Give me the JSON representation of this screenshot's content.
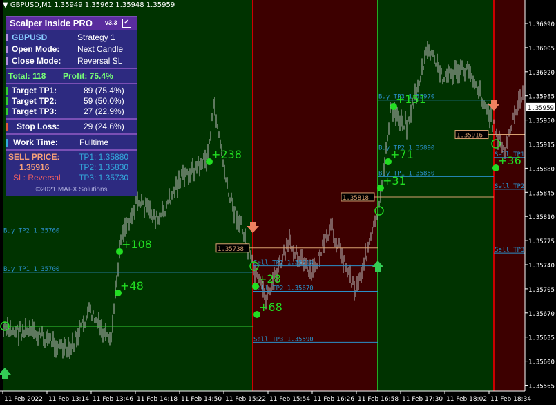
{
  "window": {
    "title": "GBPUSD,M1  1.35949 1.35962 1.35948 1.35959"
  },
  "panel": {
    "title": "Scalper Inside PRO",
    "version": "v3.3",
    "symbol": "GBPUSD",
    "strategy": "Strategy 1",
    "open_mode_label": "Open Mode:",
    "open_mode_value": "Next Candle",
    "close_mode_label": "Close Mode:",
    "close_mode_value": "Reversal SL",
    "total_label": "Total: 118",
    "profit_label": "Profit: 75.4%",
    "targets": [
      {
        "label": "Target TP1:",
        "value": "89 (75.4%)"
      },
      {
        "label": "Target TP2:",
        "value": "59 (50.0%)"
      },
      {
        "label": "Target TP3:",
        "value": "27 (22.9%)"
      }
    ],
    "stop_loss_label": "Stop Loss:",
    "stop_loss_value": "29 (24.6%)",
    "work_time_label": "Work Time:",
    "work_time_value": "Fulltime",
    "sell_price_label": "SELL PRICE:",
    "sell_price_value": "1.35916",
    "sl_text": "SL: Reversal",
    "tp1": "TP1: 1.35880",
    "tp2": "TP2: 1.35830",
    "tp3": "TP3: 1.35730",
    "footer": "©2021 MAFX Solutions"
  },
  "colors": {
    "bg": "#000000",
    "buy_zone": "#003300",
    "sell_zone": "#3d0000",
    "level_line": "#2a8fc8",
    "entry_line": "#d8a070",
    "signal_green": "#22dd22",
    "sell_arrow": "#f08060",
    "buy_arrow": "#33cc55",
    "text_cyan": "#33aadd",
    "profit_text": "#55ff55"
  },
  "price_axis": {
    "labels": [
      "1.36090",
      "1.36005",
      "1.36020",
      "1.35985",
      "1.35950",
      "1.35915",
      "1.35880",
      "1.35845",
      "1.35810",
      "1.35775",
      "1.35740",
      "1.35705",
      "1.35670",
      "1.35635",
      "1.35600",
      "1.35565"
    ],
    "current": "1.35959"
  },
  "time_axis": {
    "labels": [
      "11 Feb 2022",
      "11 Feb 13:14",
      "11 Feb 13:46",
      "11 Feb 14:18",
      "11 Feb 14:50",
      "11 Feb 15:22",
      "11 Feb 15:54",
      "11 Feb 16:26",
      "11 Feb 16:58",
      "11 Feb 17:30",
      "11 Feb 18:02",
      "11 Feb 18:34"
    ]
  },
  "chart_data": {
    "type": "line",
    "title": "GBPUSD,M1",
    "zones": [
      {
        "kind": "buy",
        "from": "11 Feb 2022",
        "to": "11 Feb 15:22"
      },
      {
        "kind": "sell",
        "from": "11 Feb 15:22",
        "to": "11 Feb 16:58"
      },
      {
        "kind": "buy",
        "from": "11 Feb 16:58",
        "to": "11 Feb 18:02"
      },
      {
        "kind": "sell",
        "from": "11 Feb 18:02",
        "to": "11 Feb 18:34"
      }
    ],
    "levels": [
      {
        "text": "Buy TP2 1.35760",
        "price": 1.3576
      },
      {
        "text": "Buy TP1 1.35700",
        "price": 1.357
      },
      {
        "text": "Sell TP1 1.35710",
        "price": 1.3571
      },
      {
        "text": "Sell TP2 1.35670",
        "price": 1.3567
      },
      {
        "text": "Sell TP3 1.35590",
        "price": 1.3559
      },
      {
        "text": "Buy TP3 1.35970",
        "price": 1.3597
      },
      {
        "text": "Buy TP2 1.35890",
        "price": 1.3589
      },
      {
        "text": "Buy TP1 1.35850",
        "price": 1.3585
      },
      {
        "text": "Sell TP1",
        "price": 1.3588
      },
      {
        "text": "Sell TP2",
        "price": 1.3583
      },
      {
        "text": "Sell TP3",
        "price": 1.3573
      }
    ],
    "entry_labels": [
      "1.35738",
      "1.35818",
      "1.35916"
    ],
    "profit_labels": [
      "+238",
      "+108",
      "+48",
      "+28",
      "+68",
      "+151",
      "+71",
      "+31",
      "+36"
    ]
  }
}
